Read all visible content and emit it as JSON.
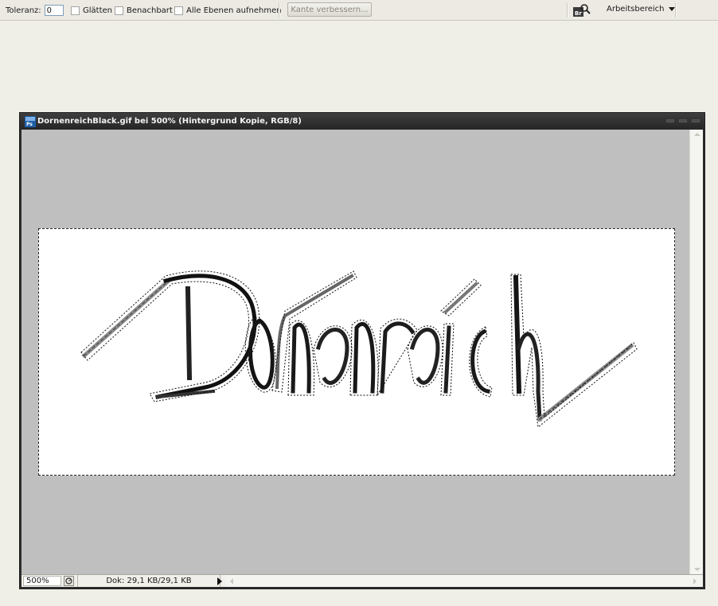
{
  "options_bar": {
    "tolerance_label": "Toleranz:",
    "tolerance_value": "0",
    "antialias_label": "Glätten",
    "contiguous_label": "Benachbart",
    "all_layers_label": "Alle Ebenen aufnehmen",
    "refine_edge_label": "Kante verbessern...",
    "workspace_label": "Arbeitsbereich",
    "bridge_icon_label": "Br"
  },
  "document": {
    "title": "DornenreichBlack.gif bei 500% (Hintergrund Kopie, RGB/8)",
    "app_icon_label": "Ps",
    "artwork_text": "Dornenreich"
  },
  "status_bar": {
    "zoom": "500%",
    "doc_info": "Dok: 29,1 KB/29,1 KB"
  },
  "colors": {
    "canvas_background": "#bfbfbf",
    "image_background": "#ffffff",
    "titlebar": "#2c2c2c"
  }
}
